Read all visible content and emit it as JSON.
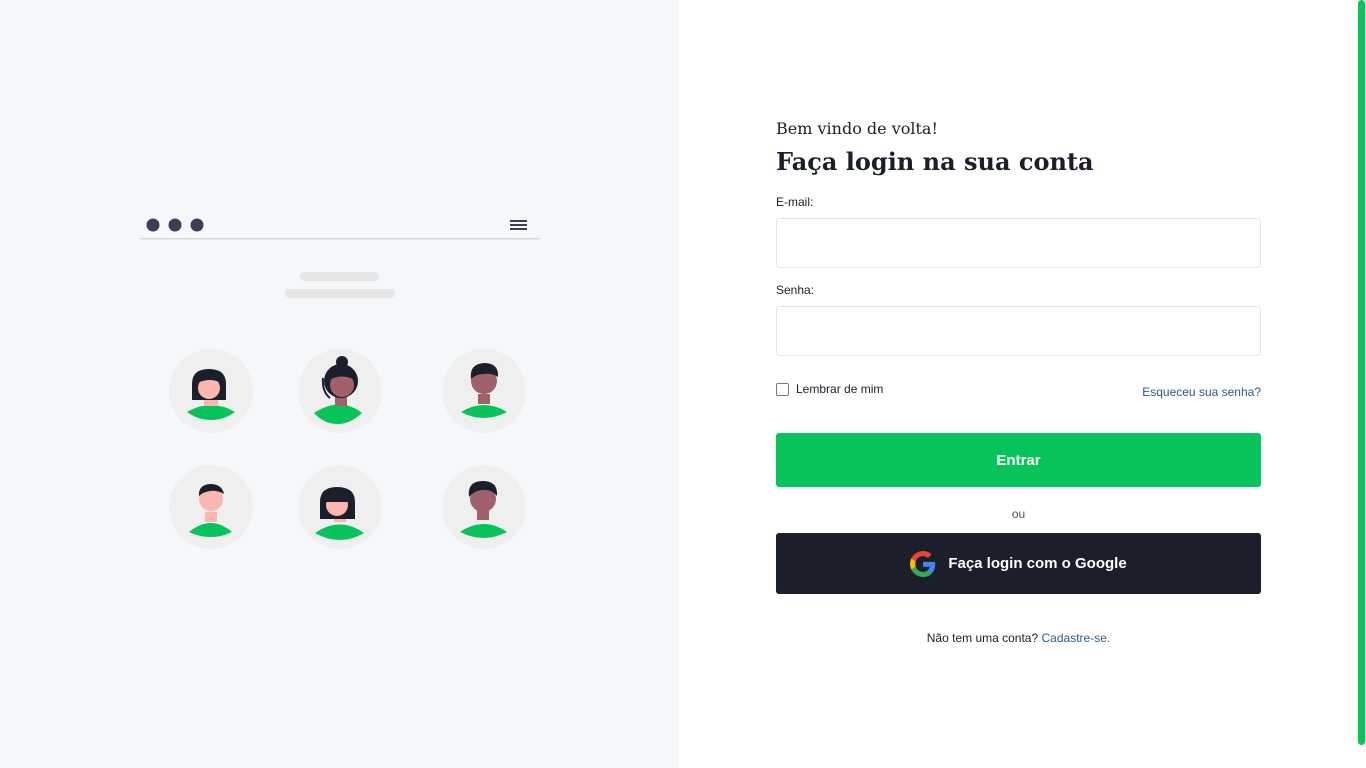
{
  "colors": {
    "accent": "#06c35a",
    "dark": "#1b1f2b",
    "link": "#2e5b8a",
    "left_background": "#f5f8fb"
  },
  "illustration": {
    "dots_icon": "window-dots-icon",
    "menu_icon": "hamburger-menu-icon",
    "avatars": [
      "woman-avatar-icon",
      "woman-bun-avatar-icon",
      "man-avatar-icon",
      "man-avatar-icon",
      "woman-avatar-icon",
      "man-avatar-icon"
    ]
  },
  "login": {
    "welcome": "Bem vindo de volta!",
    "title": "Faça login na sua conta",
    "email_label": "E-mail:",
    "email_value": "",
    "password_label": "Senha:",
    "password_value": "",
    "remember_label": "Lembrar de mim",
    "remember_checked": false,
    "forgot_link": "Esqueceu sua senha?",
    "submit_label": "Entrar",
    "or_text": "ou",
    "google_label": "Faça login com o Google",
    "google_icon": "google-icon",
    "signup_prompt": "Não tem uma conta?",
    "signup_link": "Cadastre-se."
  }
}
